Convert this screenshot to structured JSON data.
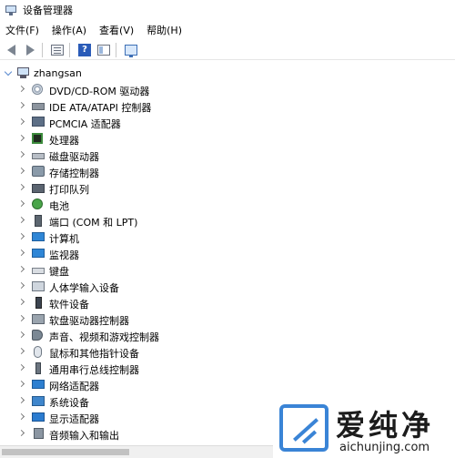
{
  "window": {
    "title": "设备管理器"
  },
  "menu": [
    {
      "label": "文件(F)"
    },
    {
      "label": "操作(A)"
    },
    {
      "label": "查看(V)"
    },
    {
      "label": "帮助(H)"
    }
  ],
  "toolbar": {
    "back_icon": "back-arrow-icon",
    "forward_icon": "forward-arrow-icon",
    "properties_icon": "properties-icon",
    "help_label": "?",
    "view_icon": "view-icon",
    "scan_icon": "scan-hardware-icon"
  },
  "tree": {
    "root": {
      "label": "zhangsan",
      "expanded": true
    },
    "nodes": [
      {
        "label": "DVD/CD-ROM 驱动器",
        "icon": "dvd-drive-icon"
      },
      {
        "label": "IDE ATA/ATAPI 控制器",
        "icon": "ide-controller-icon"
      },
      {
        "label": "PCMCIA 适配器",
        "icon": "pcmcia-adapter-icon"
      },
      {
        "label": "处理器",
        "icon": "processor-icon"
      },
      {
        "label": "磁盘驱动器",
        "icon": "disk-drive-icon"
      },
      {
        "label": "存储控制器",
        "icon": "storage-controller-icon"
      },
      {
        "label": "打印队列",
        "icon": "printer-icon"
      },
      {
        "label": "电池",
        "icon": "battery-icon"
      },
      {
        "label": "端口 (COM 和 LPT)",
        "icon": "port-icon"
      },
      {
        "label": "计算机",
        "icon": "computer-icon"
      },
      {
        "label": "监视器",
        "icon": "monitor-icon"
      },
      {
        "label": "键盘",
        "icon": "keyboard-icon"
      },
      {
        "label": "人体学输入设备",
        "icon": "hid-icon"
      },
      {
        "label": "软件设备",
        "icon": "software-device-icon"
      },
      {
        "label": "软盘驱动器控制器",
        "icon": "floppy-controller-icon"
      },
      {
        "label": "声音、视频和游戏控制器",
        "icon": "sound-controller-icon"
      },
      {
        "label": "鼠标和其他指针设备",
        "icon": "mouse-icon"
      },
      {
        "label": "通用串行总线控制器",
        "icon": "usb-icon"
      },
      {
        "label": "网络适配器",
        "icon": "network-adapter-icon"
      },
      {
        "label": "系统设备",
        "icon": "system-device-icon"
      },
      {
        "label": "显示适配器",
        "icon": "display-adapter-icon"
      },
      {
        "label": "音频输入和输出",
        "icon": "audio-io-icon"
      }
    ]
  },
  "watermark": {
    "brand": "爱纯净",
    "url": "aichunjing.com",
    "color": "#3a84d6"
  }
}
